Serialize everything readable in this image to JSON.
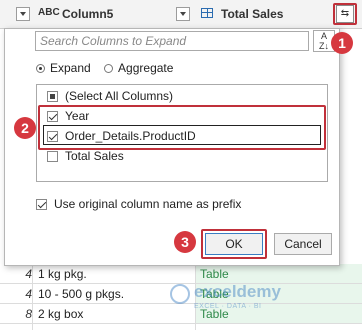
{
  "header": {
    "column5_label": "Column5",
    "column5_type": "ABC",
    "total_sales_label": "Total Sales",
    "expand_button_icon": "expand-arrows-icon"
  },
  "rows": [
    {
      "num": "4",
      "text": "1 kg pkg.",
      "value": "Table"
    },
    {
      "num": "4",
      "text": "10 - 500 g pkgs.",
      "value": "Table"
    },
    {
      "num": "8",
      "text": "2 kg box",
      "value": "Table"
    }
  ],
  "popup": {
    "search_placeholder": "Search Columns to Expand",
    "sort_icon": "sort-az-icon",
    "mode_options": [
      "Expand",
      "Aggregate"
    ],
    "mode_selected": "Expand",
    "columns": [
      {
        "label": "(Select All Columns)",
        "state": "partial"
      },
      {
        "label": "Year",
        "state": "checked"
      },
      {
        "label": "Order_Details.ProductID",
        "state": "checked"
      },
      {
        "label": "Total Sales",
        "state": "unchecked"
      }
    ],
    "prefix_label": "Use original column name as prefix",
    "prefix_checked": true,
    "ok_label": "OK",
    "cancel_label": "Cancel"
  },
  "annotations": {
    "step1": "1",
    "step2": "2",
    "step3": "3",
    "color": "#d6383f"
  },
  "watermark": {
    "name": "exceldemy",
    "tagline": "EXCEL · DATA · BI"
  }
}
